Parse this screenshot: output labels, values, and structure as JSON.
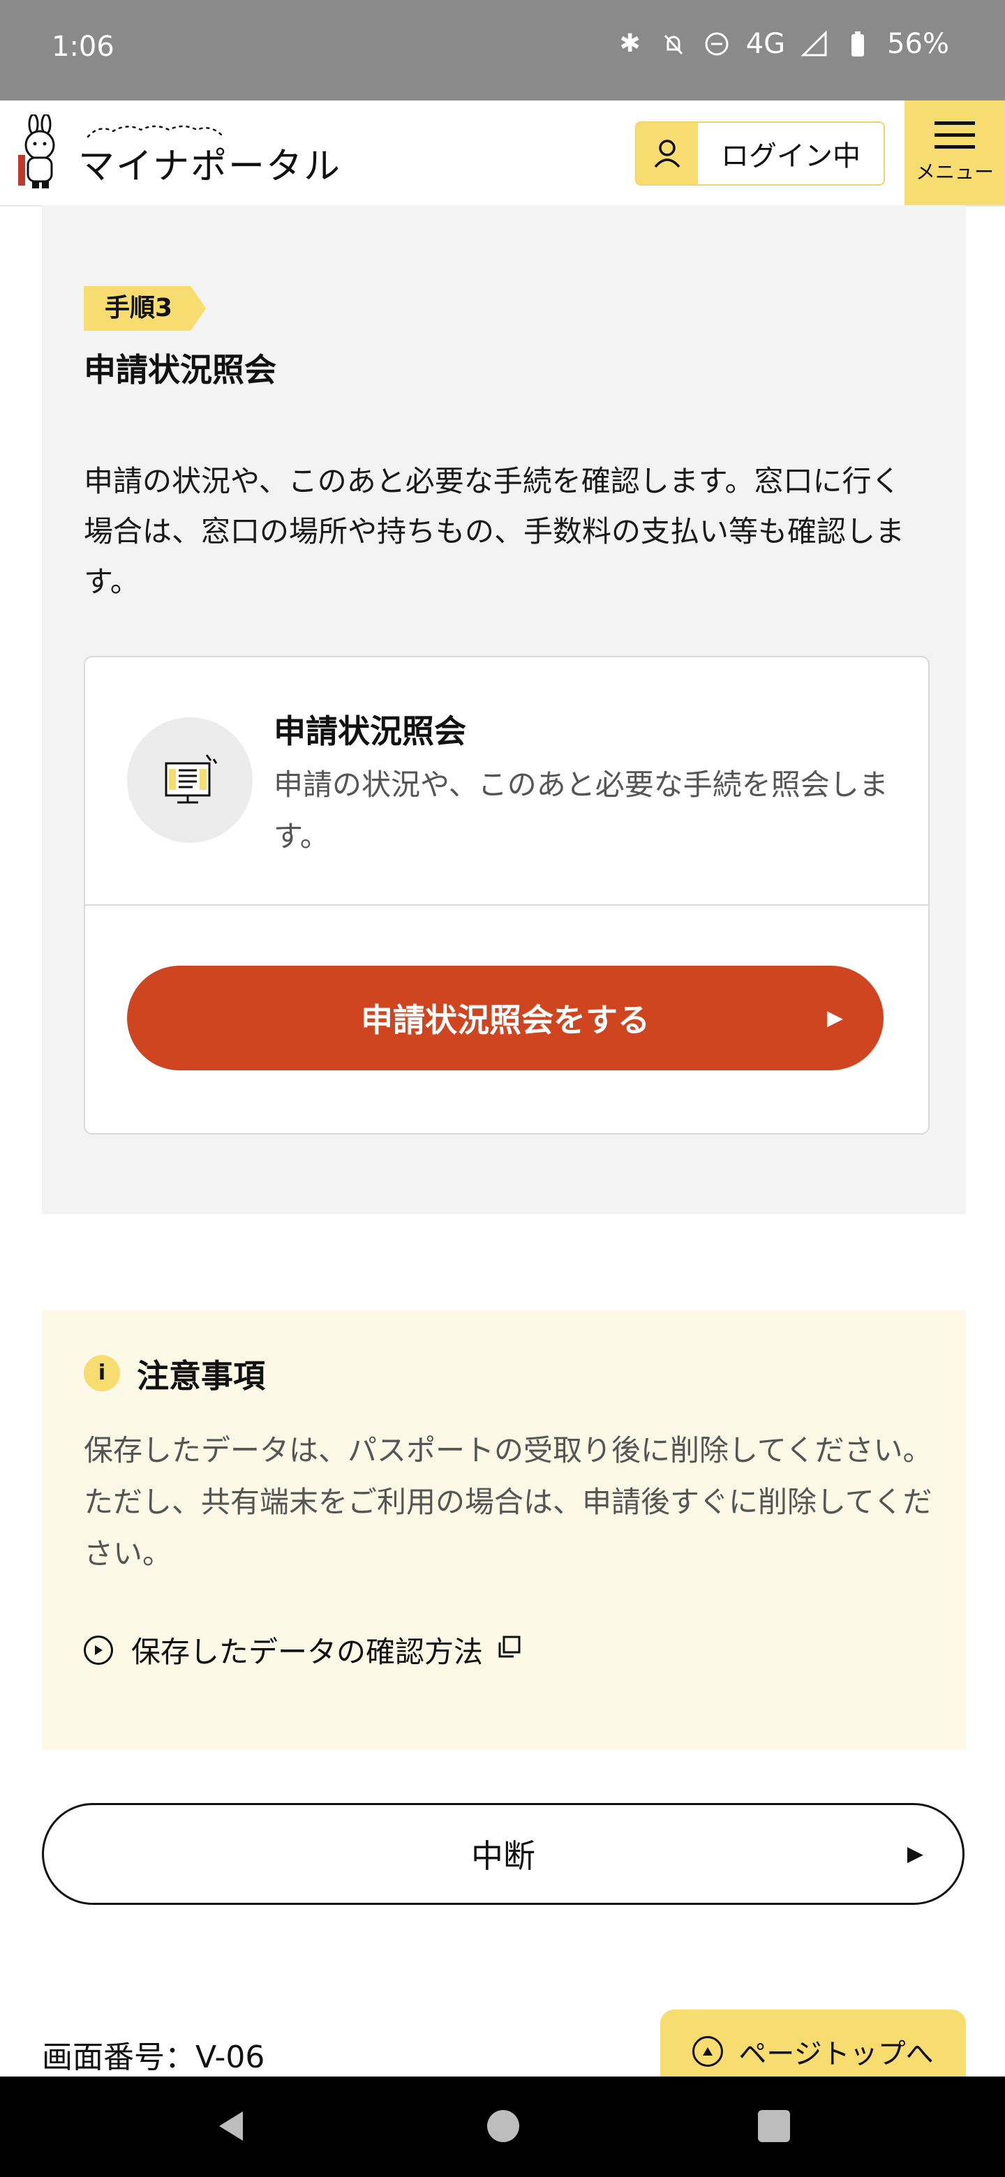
{
  "status_bar": {
    "time": "1:06",
    "network": "4G",
    "battery": "56%",
    "icons": [
      "bluetooth-icon",
      "notifications-off-icon",
      "do-not-disturb-icon",
      "signal-icon",
      "battery-icon"
    ]
  },
  "header": {
    "logo_text": "マイナポータル",
    "login_label": "ログイン中",
    "menu_label": "メニュー"
  },
  "step": {
    "tag": "手順3",
    "title": "申請状況照会",
    "description": "申請の状況や、このあと必要な手続を確認します。窓口に行く場合は、窓口の場所や持ちもの、手数料の支払い等も確認します。",
    "card": {
      "title": "申請状況照会",
      "text": "申請の状況や、このあと必要な手続を照会します。",
      "button_label": "申請状況照会をする"
    }
  },
  "notice": {
    "title": "注意事項",
    "body": "保存したデータは、パスポートの受取り後に削除してください。ただし、共有端末をご利用の場合は、申請後すぐに削除してください。",
    "link_label": "保存したデータの確認方法"
  },
  "interrupt_button": "中断",
  "screen_number": "画面番号：V-06",
  "page_top_label": "ページトップへ",
  "colors": {
    "accent_yellow": "#f7dc6f",
    "primary_red": "#cf4520",
    "section_gray": "#f3f3f3",
    "notice_bg": "#fdf9e6"
  }
}
